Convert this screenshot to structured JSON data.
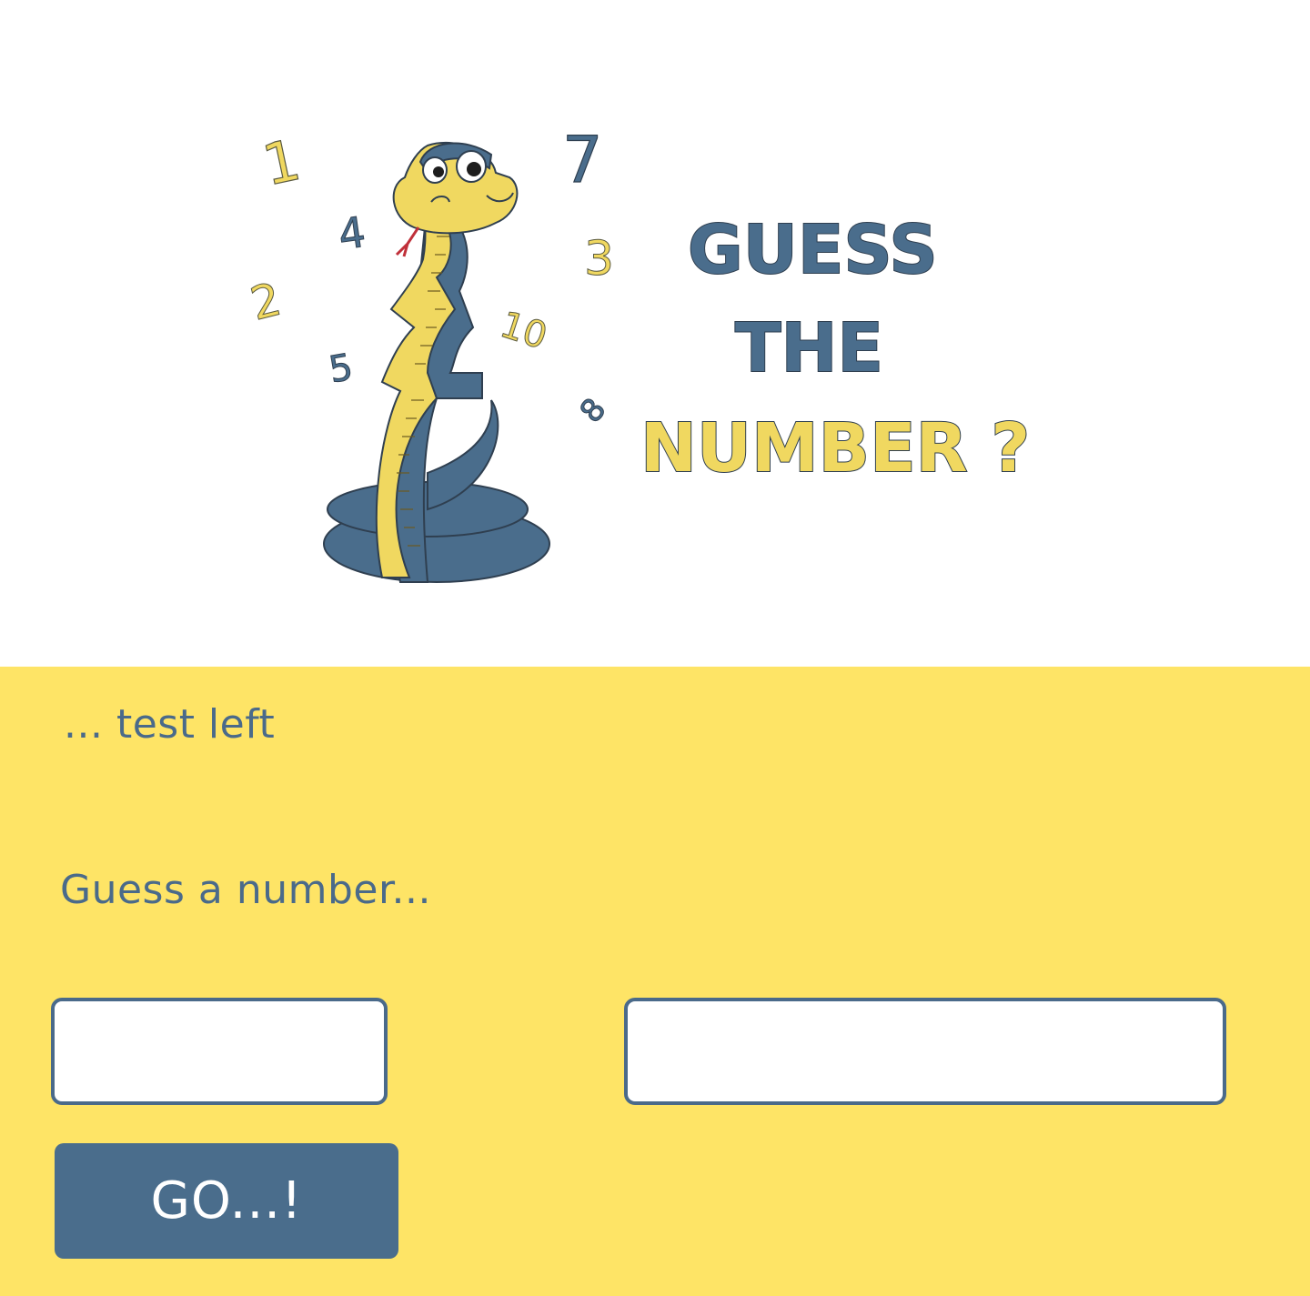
{
  "header": {
    "title_lines": [
      "GUESS",
      "THE",
      "NUMBER ?"
    ],
    "floating_numbers": [
      "1",
      "7",
      "4",
      "3",
      "2",
      "10",
      "5",
      "8"
    ],
    "colors": {
      "blue": "#4a6d8c",
      "yellow": "#f0d860",
      "outline": "#2f3f50"
    },
    "illustration": "snake-with-ruler-logo"
  },
  "game": {
    "tests_left_text": "... test left",
    "prompt_text": "Guess a number...",
    "guess_input": {
      "value": "",
      "placeholder": ""
    },
    "result_text": "",
    "go_button_label": "GO...!"
  },
  "theme": {
    "panel_background": "#fee466",
    "text_color": "#4a6a8a",
    "button_color": "#4a6d8c"
  }
}
